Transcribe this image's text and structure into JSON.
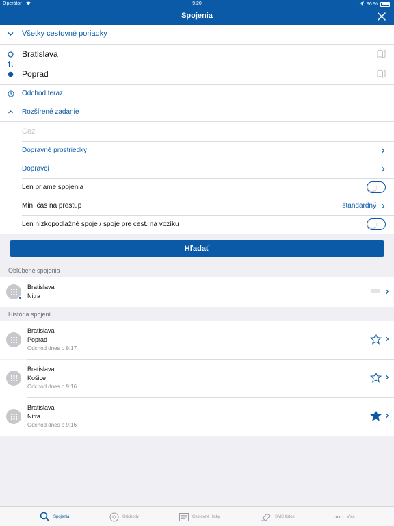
{
  "status": {
    "carrier": "Operátor",
    "time": "9:20",
    "battery": "96 %"
  },
  "nav": {
    "title": "Spojenia"
  },
  "timetables": {
    "label": "Všetky cestovné poriadky"
  },
  "route": {
    "from": "Bratislava",
    "to": "Poprad"
  },
  "departure": {
    "label": "Odchod teraz"
  },
  "advanced": {
    "label": "Rozšírené zadanie",
    "via_placeholder": "Cez",
    "transport_label": "Dopravné prostriedky",
    "carriers_label": "Dopravci",
    "direct_label": "Len priame spojenia",
    "direct_on": false,
    "transfer_label": "Min. čas na prestup",
    "transfer_value": "štandardný",
    "lowfloor_label": "Len nízkopodlažné spoje / spoje pre cest. na vozíku",
    "lowfloor_on": false
  },
  "search_button": "Hľadať",
  "favorites": {
    "header": "Obľúbené spojenia",
    "items": [
      {
        "from": "Bratislava",
        "to": "Nitra"
      }
    ]
  },
  "history": {
    "header": "História spojení",
    "items": [
      {
        "from": "Bratislava",
        "to": "Poprad",
        "time": "Odchod dnes o 9:17",
        "starred": false
      },
      {
        "from": "Bratislava",
        "to": "Košice",
        "time": "Odchod dnes o 9:16",
        "starred": false
      },
      {
        "from": "Bratislava",
        "to": "Nitra",
        "time": "Odchod dnes o 9:16",
        "starred": true
      }
    ]
  },
  "tabs": [
    {
      "label": "Spojenia",
      "active": true,
      "icon": "search-icon"
    },
    {
      "label": "Odchody",
      "active": false,
      "icon": "departures-icon"
    },
    {
      "label": "Cestovné lístky",
      "active": false,
      "icon": "tickets-icon"
    },
    {
      "label": "SMS lístok",
      "active": false,
      "icon": "sms-ticket-icon"
    },
    {
      "label": "Viac",
      "active": false,
      "icon": "more-icon"
    }
  ],
  "colors": {
    "accent": "#0a5aa7",
    "background": "#efeff4"
  }
}
